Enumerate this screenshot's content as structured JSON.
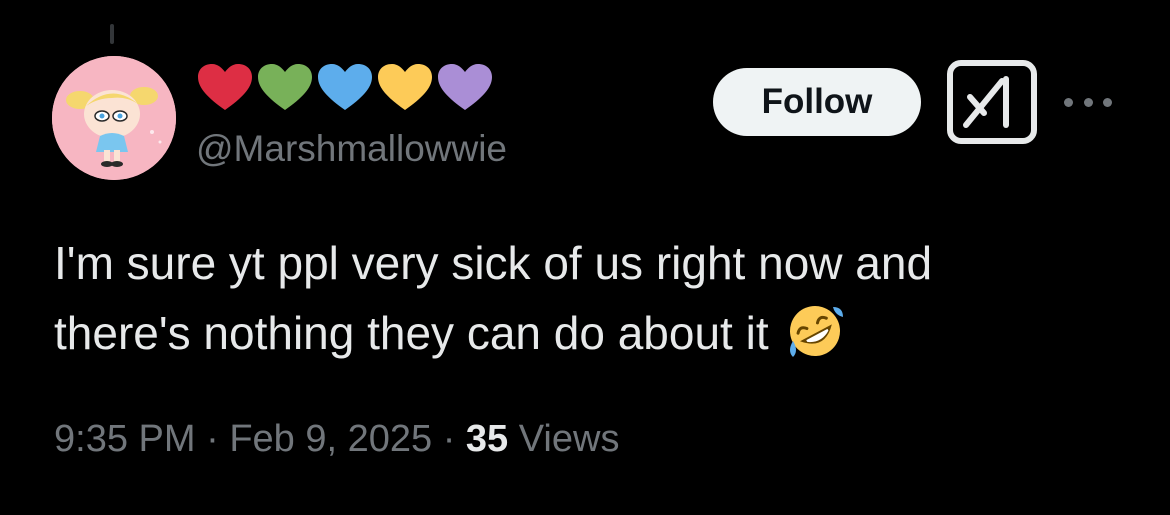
{
  "author": {
    "display_name_hearts": [
      {
        "icon": "red-heart-icon",
        "color": "#dd2e44"
      },
      {
        "icon": "green-heart-icon",
        "color": "#78b159"
      },
      {
        "icon": "blue-heart-icon",
        "color": "#5dadec"
      },
      {
        "icon": "yellow-heart-icon",
        "color": "#fdcb58"
      },
      {
        "icon": "purple-heart-icon",
        "color": "#aa8ed6"
      }
    ],
    "handle": "@Marshmallowwie"
  },
  "actions": {
    "follow_label": "Follow",
    "grok_icon": "grok-icon",
    "more_icon": "more-icon"
  },
  "tweet": {
    "lines": [
      "I'm sure yt ppl very sick of us right now and",
      "there's nothing they can do about it"
    ],
    "emoji": "rolling-on-floor-laughing-emoji"
  },
  "meta": {
    "time": "9:35 PM",
    "separator": " · ",
    "date": "Feb 9, 2025",
    "views_count": "35",
    "views_label": "Views"
  },
  "colors": {
    "background": "#000000",
    "text": "#e7e9ea",
    "secondary": "#71767b",
    "follow_bg": "#eff3f4",
    "avatar_bg": "#f7b6c2"
  }
}
